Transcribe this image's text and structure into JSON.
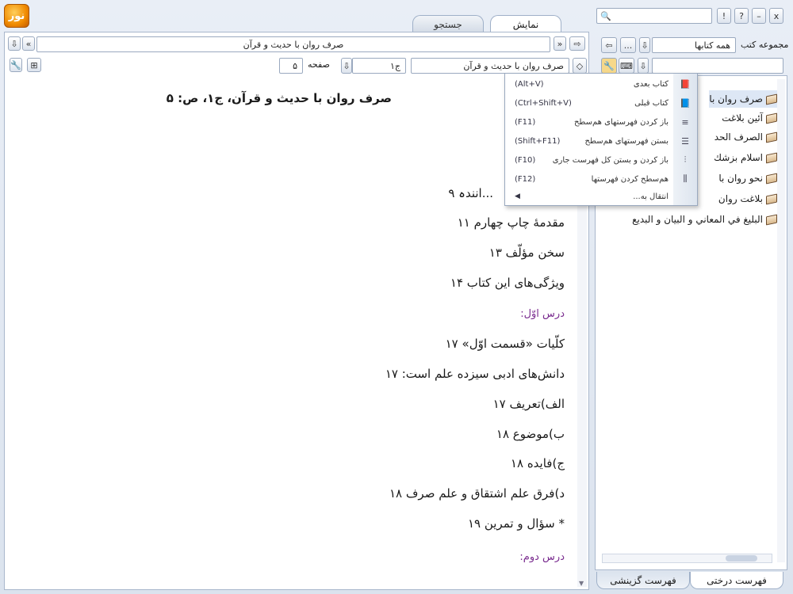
{
  "toolbar": {
    "logo_text": "نور",
    "window_controls": {
      "close": "x",
      "minimize": "–",
      "help": "?",
      "info": "!"
    },
    "search_placeholder": ""
  },
  "tabs": [
    {
      "label": "نمایش",
      "active": true
    },
    {
      "label": "جستجو",
      "active": false
    }
  ],
  "nav": {
    "title_field": "صرف روان با حديث و قرآن",
    "book_select": "صرف روان با حديث و قرآن",
    "volume_value": "ج۱",
    "page_label": "صفحه",
    "page_value": "۵"
  },
  "collection": {
    "label": "مجموعه کتب",
    "value": "همه كتابها",
    "more": "..."
  },
  "content": {
    "heading": "صرف روان با حديث و قرآن، ج۱، ص: ۵",
    "lines": [
      {
        "text": "...انندہ ۹",
        "type": "line"
      },
      {
        "text": "مقدمۀ چاپ چهارم ۱۱",
        "type": "line"
      },
      {
        "text": "سخن مؤلّف ۱۳",
        "type": "line"
      },
      {
        "text": "ويژگی‌های اين كتاب ۱۴",
        "type": "line"
      },
      {
        "text": "درس اوّل:",
        "type": "head"
      },
      {
        "text": "كلّيات «قسمت اوّل» ۱۷",
        "type": "line"
      },
      {
        "text": "دانش‌های ادبی سيزده علم است: ۱۷",
        "type": "line"
      },
      {
        "text": "الف)تعريف ۱۷",
        "type": "line"
      },
      {
        "text": "ب)موضوع ۱۸",
        "type": "line"
      },
      {
        "text": "ج)فايده ۱۸",
        "type": "line"
      },
      {
        "text": "د)فرق علم اشتقاق و علم صرف ۱۸",
        "type": "line"
      },
      {
        "text": "* سؤال و تمرين ۱۹",
        "type": "line"
      },
      {
        "text": "درس دوم:",
        "type": "head"
      }
    ]
  },
  "tree": {
    "items": [
      {
        "label": "صرف روان با",
        "selected": true
      },
      {
        "label": "آئين بلاغت"
      },
      {
        "label": "الصرف الحد"
      },
      {
        "label": "اسلام بزشك"
      },
      {
        "label": "نحو روان با"
      },
      {
        "label": "بلاغت روان"
      },
      {
        "label": "البليغ في المعاني و البيان و البديع"
      }
    ]
  },
  "popup_menu": {
    "items": [
      {
        "label": "كتاب بعدی",
        "shortcut": "(Alt+V)",
        "icon": "next-book-icon"
      },
      {
        "label": "كتاب قبلی",
        "shortcut": "(Ctrl+Shift+V)",
        "icon": "previous-book-icon"
      },
      {
        "label": "باز كردن فهرستهای هم‌سطح",
        "shortcut": "(F11)",
        "icon": "expand-level-icon"
      },
      {
        "label": "بستن فهرستهای هم‌سطح",
        "shortcut": "(Shift+F11)",
        "icon": "collapse-level-icon"
      },
      {
        "label": "باز كردن و بستن كل فهرست جاری",
        "shortcut": "(F10)",
        "icon": "toggle-all-icon"
      },
      {
        "label": "هم‌سطح كردن فهرستها",
        "shortcut": "(F12)",
        "icon": "align-level-icon"
      },
      {
        "label": "انتقال به...",
        "shortcut": "",
        "icon": "submenu-arrow-icon"
      }
    ]
  },
  "bottom_tabs": [
    {
      "label": "فهرست درختی",
      "active": true
    },
    {
      "label": "فهرست گزينشی",
      "active": false
    }
  ]
}
